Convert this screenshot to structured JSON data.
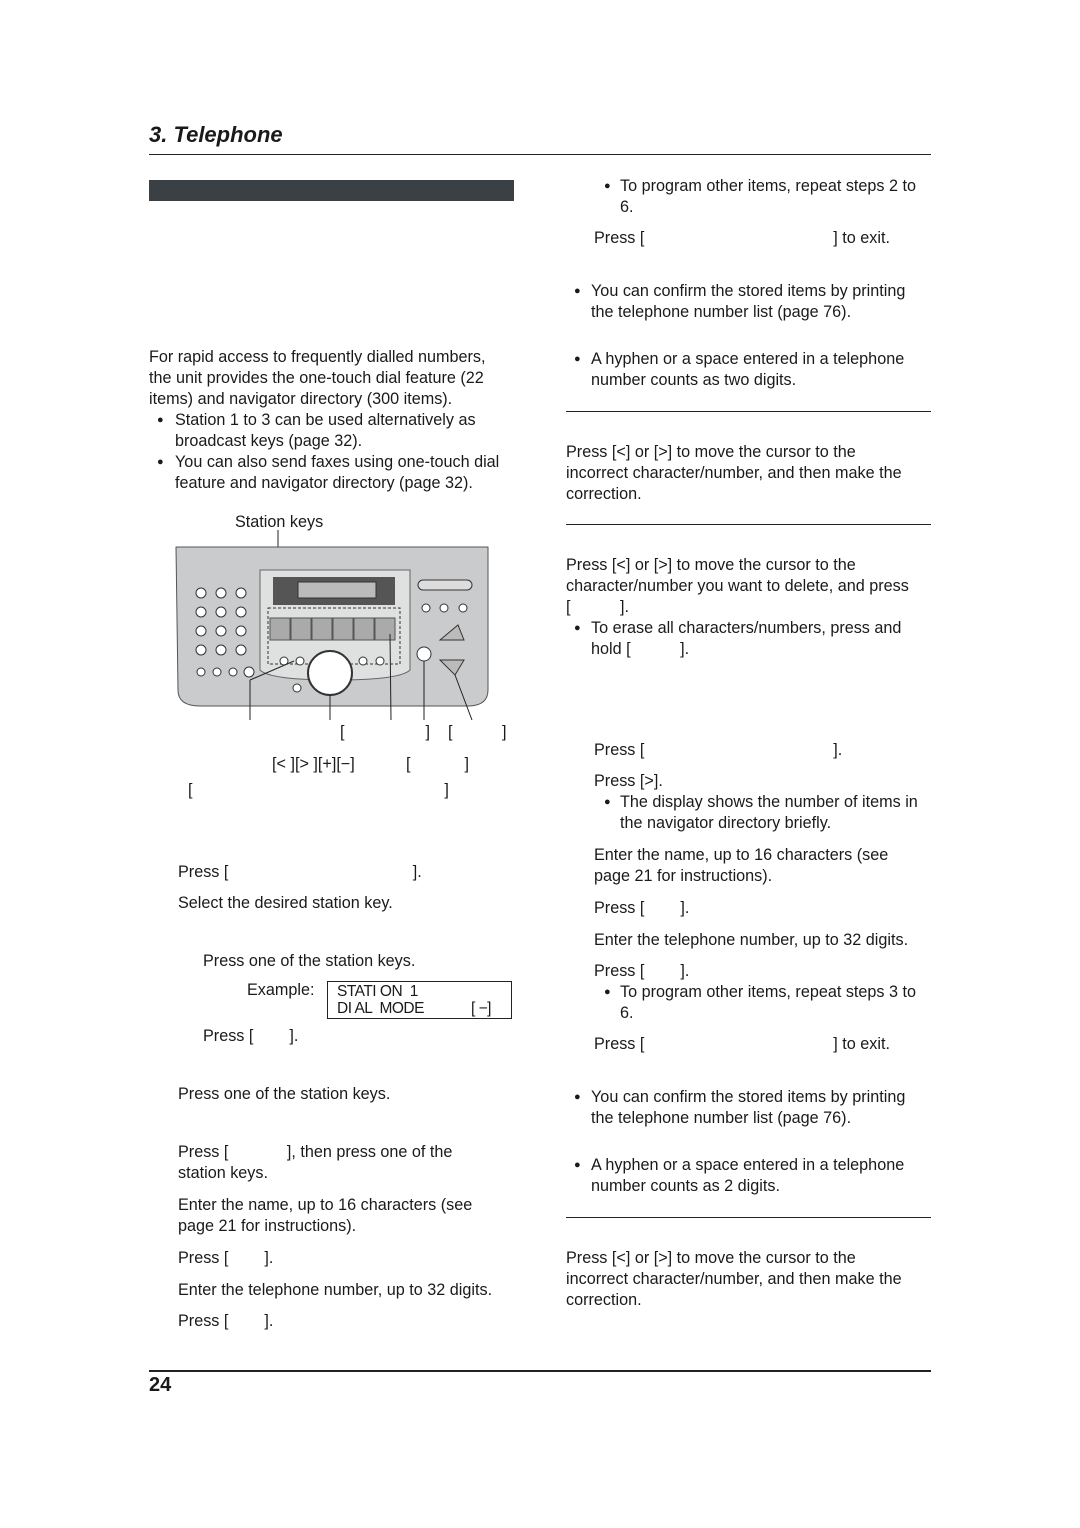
{
  "header": {
    "title": "3. Telephone"
  },
  "page_number": "24",
  "left": {
    "lines": [
      "For rapid access to frequently dialled numbers,",
      "the unit provides the one-touch dial feature (22",
      "items) and navigator directory (300 items).",
      "Station 1 to 3 can be used alternatively as",
      "broadcast keys (page 32).",
      "You can also send faxes using one-touch dial",
      "feature and navigator directory (page 32).",
      "Station keys",
      "[                  ]",
      "[           ]",
      "[< ][> ][+][−]",
      "[            ]",
      "[                                                        ]",
      "Press [                                         ].",
      "Select the desired station key.",
      "Press one of the station keys.",
      "Example:",
      "Press [        ].",
      "Press one of the station keys.",
      "Press [             ], then press one of the",
      "station keys.",
      "Enter the name, up to 16 characters (see",
      "page 21 for instructions).",
      "Press [        ].",
      "Enter the telephone number, up to 32 digits.",
      "Press [        ]."
    ]
  },
  "display": {
    "line1": "STATI ON  1",
    "line2": "DI AL  MODE",
    "line2_value": "[ −]"
  },
  "right": {
    "lines": [
      "To program other items, repeat steps 2 to",
      "6.",
      "Press [                                          ] to exit.",
      "You can confirm the stored items by printing",
      "the telephone number list (page 76).",
      "A hyphen or a space entered in a telephone",
      "number counts as two digits.",
      "Press [<] or [>] to move the cursor to the",
      "incorrect character/number, and then make the",
      "correction.",
      "Press [<] or [>] to move the cursor to the",
      "character/number you want to delete, and press",
      "[           ].",
      "To erase all characters/numbers, press and",
      "hold [           ].",
      "Press [                                          ].",
      "Press [>].",
      "The display shows the number of items in",
      "the navigator directory briefly.",
      "Enter the name, up to 16 characters (see",
      "page 21 for instructions).",
      "Press [        ].",
      "Enter the telephone number, up to 32 digits.",
      "Press [        ].",
      "To program other items, repeat steps 3 to",
      "6.",
      "Press [                                          ] to exit.",
      "You can confirm the stored items by printing",
      "the telephone number list (page 76).",
      "A hyphen or a space entered in a telephone",
      "number counts as 2 digits.",
      "Press [<] or [>] to move the cursor to the",
      "incorrect character/number, and then make the",
      "correction."
    ]
  },
  "colors": {
    "section_bar": "#3b4045",
    "device_body": "#c9cbcc"
  }
}
